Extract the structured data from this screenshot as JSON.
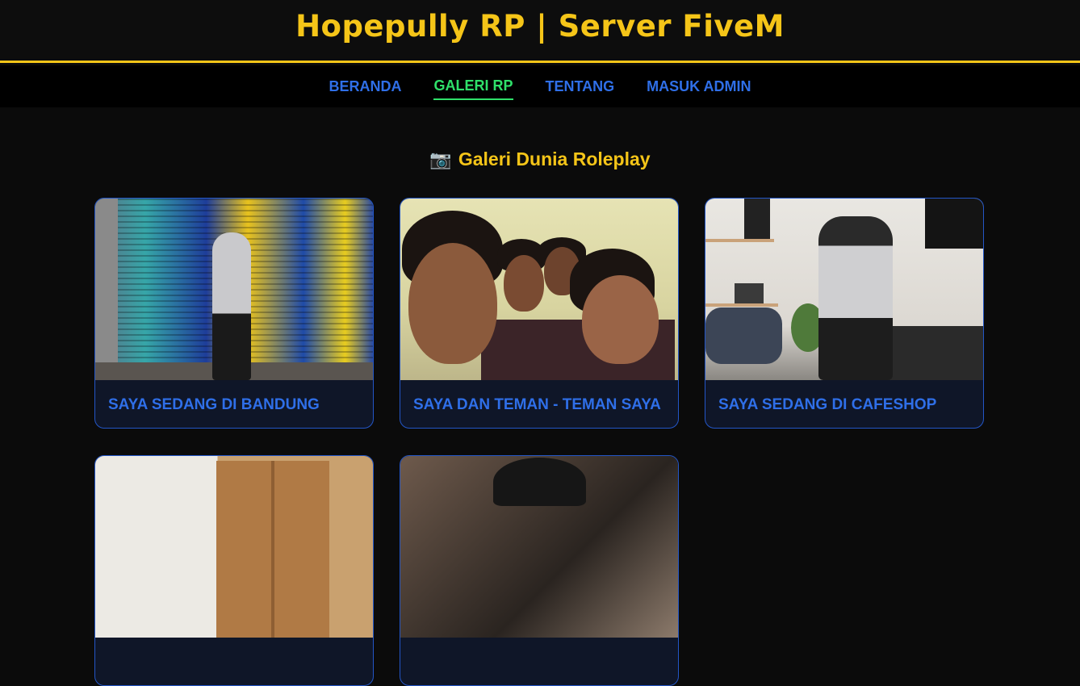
{
  "header": {
    "title": "Hopepully RP | Server FiveM"
  },
  "nav": {
    "items": [
      {
        "label": "BERANDA",
        "active": false
      },
      {
        "label": "GALERI RP",
        "active": true
      },
      {
        "label": "TENTANG",
        "active": false
      },
      {
        "label": "MASUK ADMIN",
        "active": false
      }
    ]
  },
  "gallery": {
    "icon": "📷",
    "title": "Galeri Dunia Roleplay",
    "items": [
      {
        "caption": "SAYA SEDANG DI BANDUNG"
      },
      {
        "caption": "SAYA DAN TEMAN - TEMAN SAYA"
      },
      {
        "caption": "SAYA SEDANG DI CAFESHOP"
      },
      {
        "caption": ""
      },
      {
        "caption": ""
      }
    ]
  },
  "colors": {
    "accent": "#f5c518",
    "link": "#2f6fe8",
    "active": "#2fe06a",
    "card_border": "#2356c7"
  }
}
